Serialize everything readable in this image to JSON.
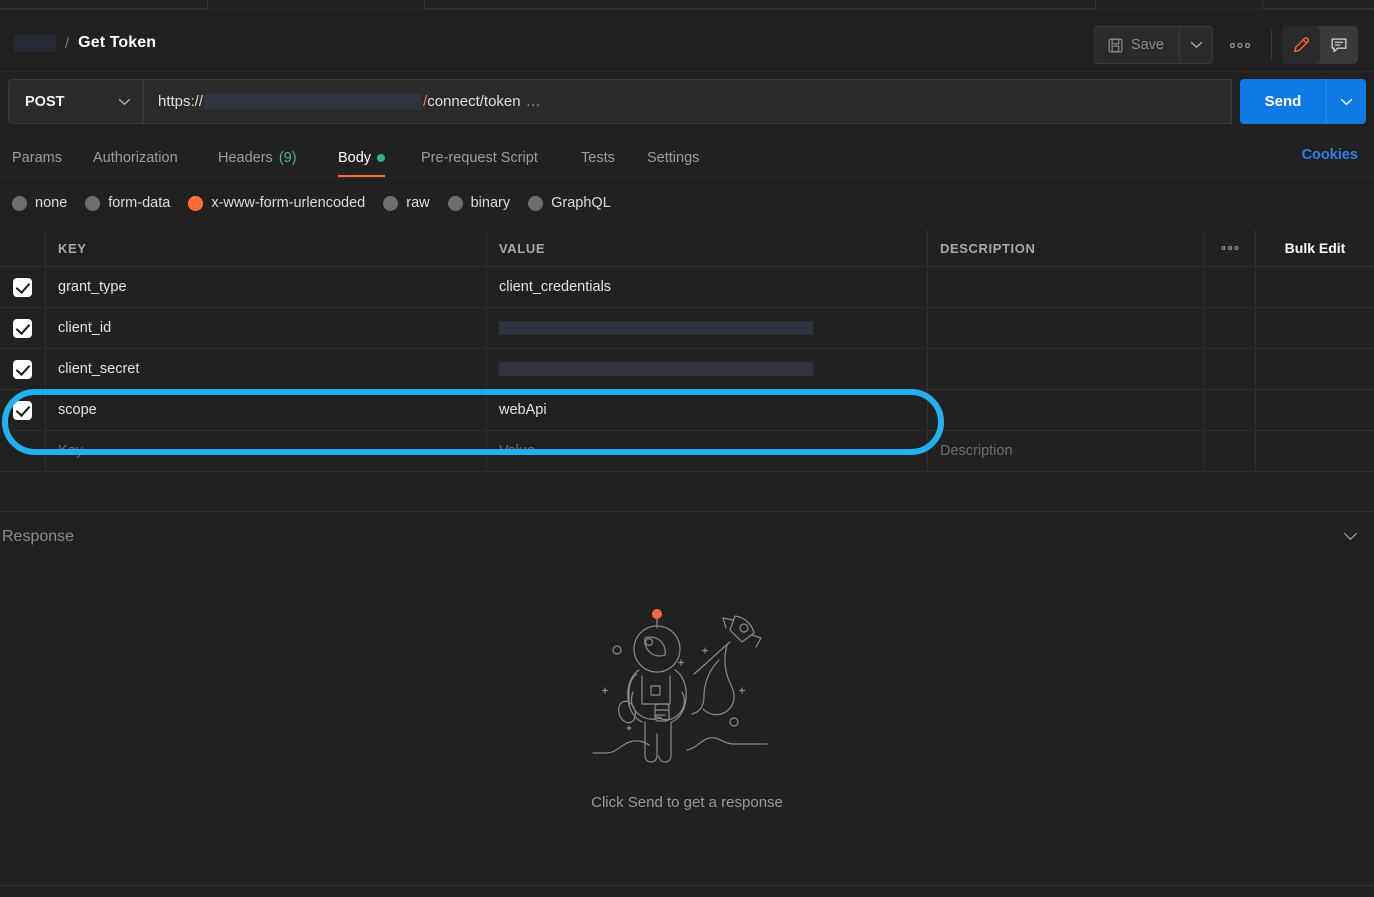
{
  "header": {
    "breadcrumb_redacted": "",
    "breadcrumb_separator": "/",
    "title": "Get Token",
    "save_label": "Save",
    "save_caret_icon": "chevron-down-icon",
    "more_label": "●●●",
    "edit_icon": "pencil-icon",
    "comment_icon": "comment-icon"
  },
  "request": {
    "method": "POST",
    "method_caret_icon": "chevron-down-icon",
    "url_scheme": "https://",
    "url_host_redacted": "",
    "url_slash": "/",
    "url_path": "connect/token",
    "url_ellipsis": "…",
    "send_label": "Send",
    "send_caret_icon": "chevron-down-icon"
  },
  "tabs": [
    {
      "label": "Params",
      "active": false,
      "count": ""
    },
    {
      "label": "Authorization",
      "active": false,
      "count": ""
    },
    {
      "label": "Headers",
      "active": false,
      "count": "(9)"
    },
    {
      "label": "Body",
      "active": true,
      "count": ""
    },
    {
      "label": "Pre-request Script",
      "active": false,
      "count": ""
    },
    {
      "label": "Tests",
      "active": false,
      "count": ""
    },
    {
      "label": "Settings",
      "active": false,
      "count": ""
    }
  ],
  "cookies_link": "Cookies",
  "body_types": [
    {
      "label": "none",
      "selected": false
    },
    {
      "label": "form-data",
      "selected": false
    },
    {
      "label": "x-www-form-urlencoded",
      "selected": true
    },
    {
      "label": "raw",
      "selected": false
    },
    {
      "label": "binary",
      "selected": false
    },
    {
      "label": "GraphQL",
      "selected": false
    }
  ],
  "table": {
    "columns": {
      "key": "KEY",
      "value": "VALUE",
      "description": "DESCRIPTION"
    },
    "more_label": "●●●",
    "bulk_edit_label": "Bulk Edit",
    "rows": [
      {
        "checked": true,
        "key": "grant_type",
        "value": "client_credentials",
        "value_redacted": false,
        "description": "",
        "highlighted": false
      },
      {
        "checked": true,
        "key": "client_id",
        "value": "",
        "value_redacted": true,
        "description": "",
        "highlighted": false
      },
      {
        "checked": true,
        "key": "client_secret",
        "value": "",
        "value_redacted": true,
        "description": "",
        "highlighted": false
      },
      {
        "checked": true,
        "key": "scope",
        "value": "webApi",
        "value_redacted": false,
        "description": "",
        "highlighted": true
      }
    ],
    "placeholder_row": {
      "key": "Key",
      "value": "Value",
      "description": "Description"
    }
  },
  "response": {
    "label": "Response",
    "collapse_icon": "chevron-down-icon",
    "empty_caption": "Click Send to get a response",
    "illustration": "astronaut-rocket-illustration"
  },
  "colors": {
    "accent_orange": "#ff6c37",
    "send_blue": "#0f7ae5",
    "link_blue": "#2a7fe8",
    "annotation_cyan": "#22b0f0",
    "status_green": "#2eb67d",
    "background": "#212121",
    "redaction": "#30343f"
  }
}
